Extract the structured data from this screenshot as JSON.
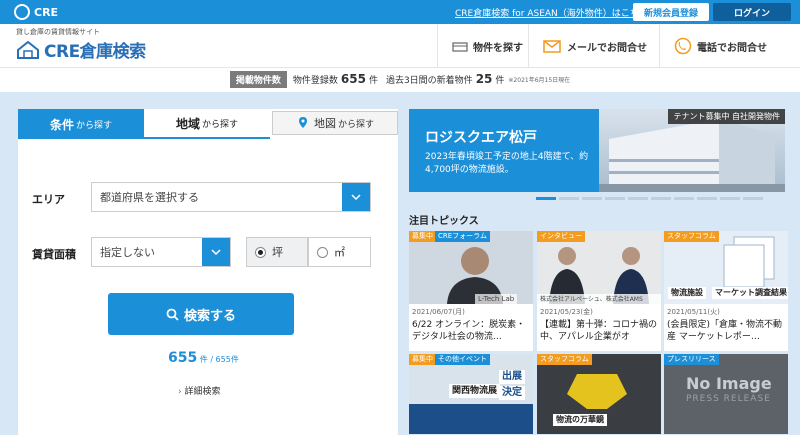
{
  "topbar": {
    "brand": "CRE",
    "asean_link": "CRE倉庫検索 for ASEAN（海外物件）はこちら",
    "register_label": "新規会員登録",
    "login_label": "ログイン"
  },
  "header": {
    "logo_sub": "貸し倉庫の賃貸情報サイト",
    "logo_main": "CRE倉庫検索",
    "nav": [
      {
        "label": "物件を探す",
        "icon": "warehouse-icon"
      },
      {
        "label": "メールでお問合せ",
        "icon": "mail-icon"
      },
      {
        "label": "電話でお問合せ",
        "icon": "phone-icon"
      }
    ]
  },
  "stats": {
    "badge": "掲載物件数",
    "registered_label": "物件登録数",
    "registered_count": "655",
    "unit": "件",
    "new_label": "過去3日間の新着物件",
    "new_count": "25",
    "note": "※2021年6月15日現在"
  },
  "search": {
    "tabs": [
      {
        "main": "条件",
        "sub": "から探す"
      },
      {
        "main": "地域",
        "sub": "から探す"
      },
      {
        "main": "地図",
        "sub": "から探す"
      }
    ],
    "area_label": "エリア",
    "area_value": "都道府県を選択する",
    "size_label": "賃貸面積",
    "size_value": "指定しない",
    "unit_tsubo": "坪",
    "unit_m2": "㎡",
    "search_button": "検索する",
    "count_found": "655",
    "count_total": "件 / 655件",
    "detail_link": "詳細検索"
  },
  "banner": {
    "tag": "テナント募集中 自社開発物件",
    "title": "ロジスクエア松戸",
    "desc": "2023年春頃竣工予定の地上4階建て、約4,700坪の物流施設。"
  },
  "topics": {
    "title": "注目トピックス",
    "cards": [
      {
        "label1": "募集中",
        "label2": "CREフォーラム",
        "caption": "L-Tech Lab",
        "date": "2021/06/07(月)",
        "text": "6/22 オンライン：脱炭素・デジタル社会の物流…"
      },
      {
        "label1": "インタビュー",
        "caption": "株式会社アルペーシュ、株式会社AMS",
        "date": "2021/05/23(金)",
        "text": "【連載】第十弾：コロナ禍の中、アパレル企業がオ"
      },
      {
        "label1": "スタッフコラム",
        "overlay1": "物流施設",
        "overlay2": "マーケット調査結果",
        "date": "2021/05/11(火)",
        "text": "(会員限定)「倉庫・物流不動産 マーケットレポー…"
      }
    ],
    "cards_bottom": [
      {
        "label1": "募集中",
        "label2": "その他イベント",
        "overlay1": "出展",
        "overlay2": "決定",
        "overlay3": "関西物流展"
      },
      {
        "label1": "スタッフコラム",
        "overlay1": "物流の万華鏡"
      },
      {
        "label1": "プレスリリース",
        "overlay1": "No Image",
        "overlay2": "PRESS RELEASE"
      }
    ]
  }
}
